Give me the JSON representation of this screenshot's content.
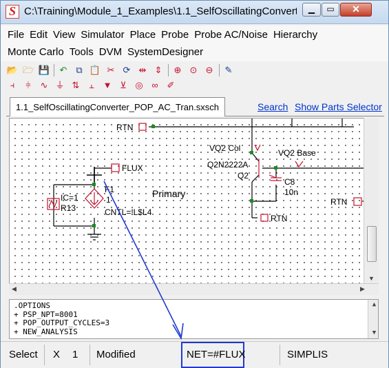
{
  "window": {
    "title": "C:\\Training\\Module_1_Examples\\1.1_SelfOscillatingConvert..."
  },
  "menus": {
    "row1": [
      "File",
      "Edit",
      "View",
      "Simulator",
      "Place",
      "Probe",
      "Probe AC/Noise",
      "Hierarchy"
    ],
    "row2": [
      "Monte Carlo",
      "Tools",
      "DVM",
      "SystemDesigner"
    ]
  },
  "toolbar_icons": {
    "row1": [
      "open-icon",
      "open-folder-icon",
      "save-icon",
      "undo-icon",
      "copy-icon",
      "paste-icon",
      "cut-icon",
      "rotate-icon",
      "mirror-icon",
      "flip-icon",
      "zoom-in-icon",
      "zoom-full-icon",
      "zoom-out-icon",
      "wire-pen-icon"
    ],
    "row2": [
      "resistor-icon",
      "capacitor-icon",
      "inductor-icon",
      "ground-icon",
      "current-probe-icon",
      "voltage-probe-icon",
      "diode-icon",
      "npn-icon",
      "source-icon",
      "transformer-icon",
      "pen-icon"
    ]
  },
  "tab": {
    "label": "1.1_SelfOscillatingConverter_POP_AC_Tran.sxsch"
  },
  "links": {
    "search": "Search",
    "parts": "Show Parts Selector"
  },
  "schematic": {
    "labels": {
      "rtn_top": "RTN",
      "flux": "FLUX",
      "ic": "IC=1",
      "r13": "R13",
      "f1": "F1",
      "f1_pin": "1",
      "primary": "Primary",
      "cntl": "CNTL=!L$L4",
      "vq2_col": "VQ2 Col",
      "q2_model": "Q2N2222A",
      "q2": "Q2",
      "vq2_base": "VQ2 Base",
      "c8": "C8",
      "c8_val": "10n",
      "rtn_mid": "RTN",
      "rtn_right": "RTN"
    },
    "colors": {
      "wire": "#000000",
      "junction": "#1e8a25",
      "component": "#c8102e",
      "annotation_arrow": "#1f3ad1"
    }
  },
  "netlist": {
    "lines": [
      ".OPTIONS",
      "+ PSP_NPT=8001",
      "+ POP_OUTPUT_CYCLES=3",
      "+ NEW_ANALYSIS"
    ]
  },
  "status": {
    "mode": "Select",
    "axis": "X",
    "value": "1",
    "state": "Modified",
    "net": "NET=#FLUX",
    "simulator": "SIMPLIS"
  }
}
